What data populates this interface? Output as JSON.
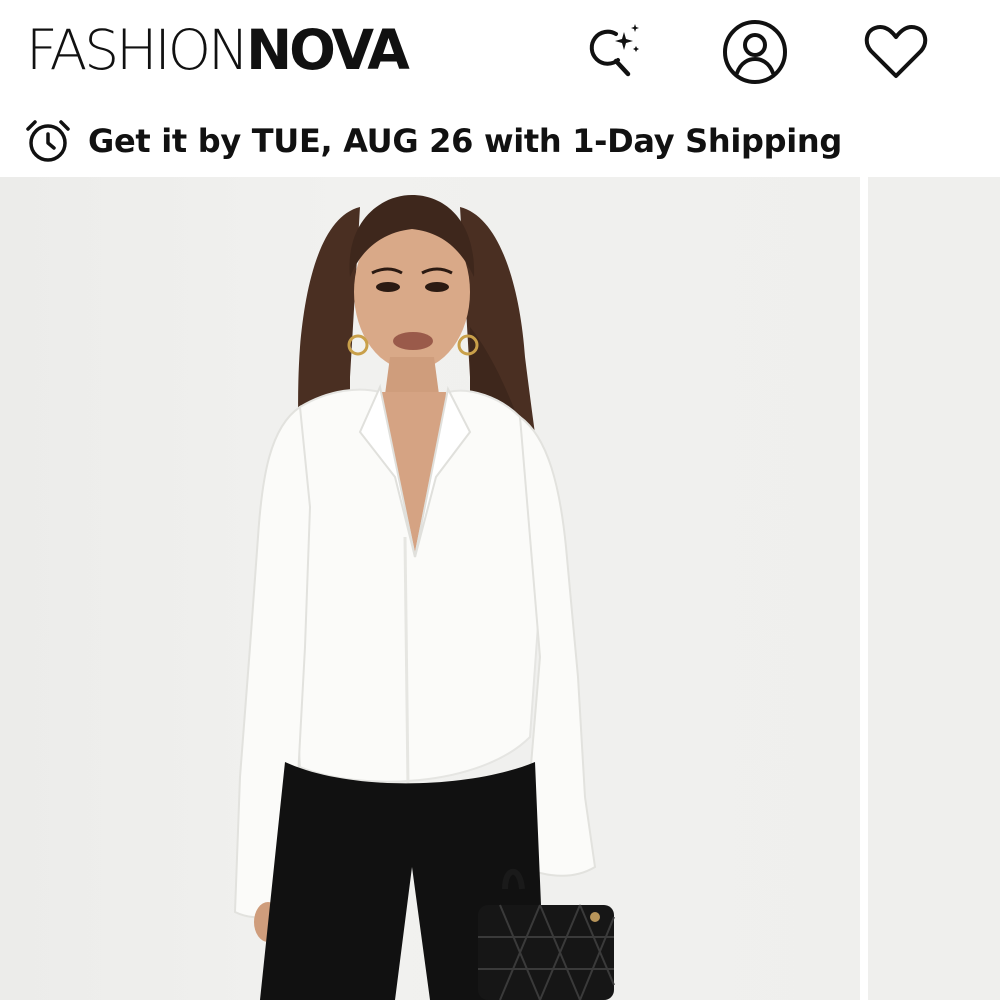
{
  "header": {
    "logo_light": "FASHION",
    "logo_bold": "NOVA",
    "icons": {
      "search": "ai-search-sparkle-icon",
      "account": "user-account-icon",
      "wishlist": "heart-icon"
    }
  },
  "shipping_banner": {
    "icon": "alarm-clock-icon",
    "prefix": "Get it by ",
    "date": "TUE, AUG 26",
    "suffix": " with 1-Day Shipping"
  },
  "gallery": {
    "current_image": "product-photo-model-white-button-up-blouse-black-pants-quilted-black-handbag",
    "next_image": "product-photo-next-partial"
  },
  "colors": {
    "text": "#111111",
    "background": "#ffffff",
    "photo_background": "#efefed"
  }
}
